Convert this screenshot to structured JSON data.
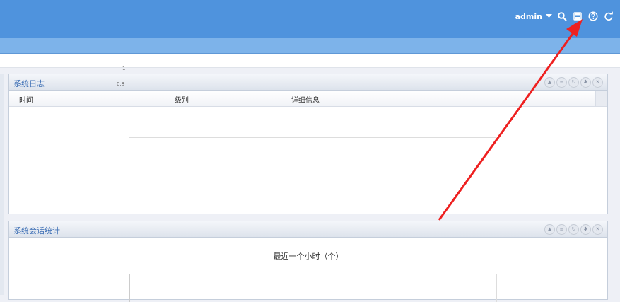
{
  "header": {
    "username": "admin",
    "icons": [
      "chevron-down-icon",
      "search-icon",
      "save-icon",
      "help-icon",
      "logout-icon"
    ]
  },
  "log_panel": {
    "title": "系统日志",
    "columns": [
      "时间",
      "级别",
      "详细信息"
    ],
    "rows": [],
    "tools": [
      "collapse-icon",
      "list-icon",
      "refresh-icon",
      "settings-icon",
      "close-icon"
    ]
  },
  "session_panel": {
    "title": "系统会话统计",
    "tools": [
      "collapse-icon",
      "list-icon",
      "refresh-icon",
      "settings-icon",
      "close-icon"
    ]
  },
  "chart_data": {
    "type": "line",
    "title": "最近一个小时（个）",
    "yticks": [
      "1",
      "0.8"
    ],
    "ylim": [
      0,
      1
    ],
    "x": [],
    "series": [],
    "grid": true
  },
  "colors": {
    "header_bg": "#4f93dd",
    "subbar_bg": "#7db3ea",
    "panel_title": "#3d6fb5",
    "annotation_arrow": "#ee2020"
  }
}
